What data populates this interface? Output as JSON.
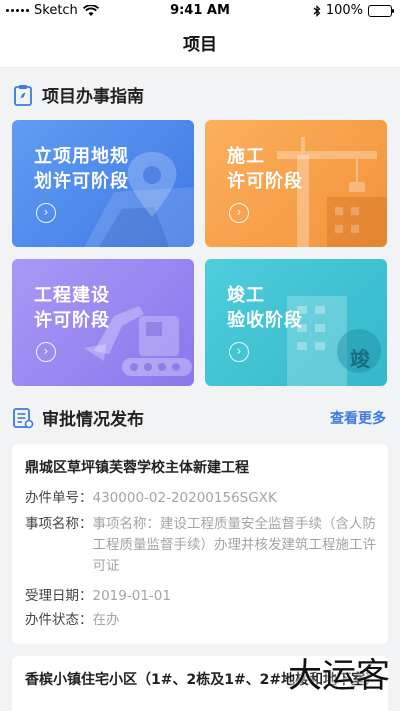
{
  "status_bar": {
    "carrier": "Sketch",
    "time": "9:41 AM",
    "battery": "100%"
  },
  "nav": {
    "title": "项目"
  },
  "guide": {
    "title": "项目办事指南",
    "stages": [
      {
        "line1": "立项用地规",
        "line2": "划许可阶段",
        "color": "#4a86ea"
      },
      {
        "line1": "施工",
        "line2": "许可阶段",
        "color": "#f59e46"
      },
      {
        "line1": "工程建设",
        "line2": "许可阶段",
        "color": "#9685f1"
      },
      {
        "line1": "竣工",
        "line2": "验收阶段",
        "color": "#40c2d3"
      }
    ],
    "stage4_badge": "竣",
    "arrow_glyph": "›"
  },
  "approvals": {
    "title": "审批情况发布",
    "see_more": "查看更多",
    "items": [
      {
        "project": "鼎城区草坪镇芙蓉学校主体新建工程",
        "number_label": "办件单号：",
        "number": "430000-02-20200156SGXK",
        "matter_label": "事项名称：",
        "matter": "事项名称：建设工程质量安全监督手续（含人防工程质量监督手续）办理并核发建筑工程施工许可证",
        "date_label": "受理日期：",
        "date": "2019-01-01",
        "status_label": "办件状态：",
        "status": "在办"
      },
      {
        "project": "香槟小镇住宅小区（1#、2栋及1#、2#地楼和地下室）"
      }
    ]
  },
  "watermark": "大运客"
}
